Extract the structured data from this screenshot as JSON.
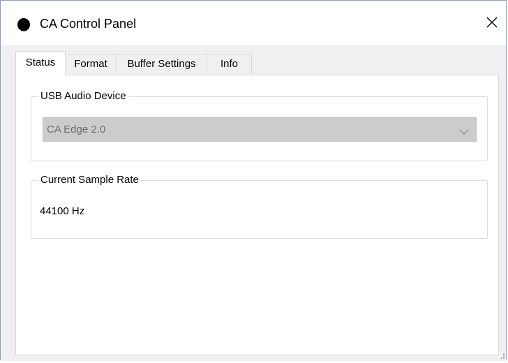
{
  "window": {
    "title": "CA Control Panel",
    "icon": "app-icon",
    "close_label": "✕"
  },
  "tabs": [
    {
      "label": "Status",
      "active": true
    },
    {
      "label": "Format",
      "active": false
    },
    {
      "label": "Buffer Settings",
      "active": false
    },
    {
      "label": "Info",
      "active": false
    }
  ],
  "status": {
    "usb_group_label": "USB Audio Device",
    "usb_device_selected": "CA Edge 2.0",
    "sample_rate_group_label": "Current Sample Rate",
    "sample_rate_value": "44100 Hz"
  },
  "colors": {
    "window_background": "#f0f0f0",
    "panel_background": "#ffffff",
    "disabled_combo": "#cccccc",
    "disabled_text": "#6d6d6d"
  }
}
